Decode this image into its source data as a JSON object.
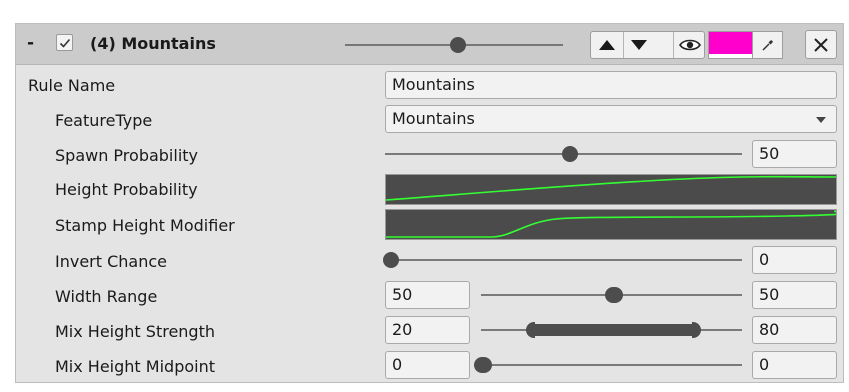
{
  "header": {
    "collapse_symbol": "-",
    "enabled": true,
    "title": "(4) Mountains",
    "preview_slider_value": 0.52,
    "color": "#ff00cc",
    "icons": {
      "move_up": "triangle-up-icon",
      "move_down": "triangle-down-icon",
      "visibility": "eye-icon",
      "picker": "eyedropper-icon",
      "remove": "close-icon"
    }
  },
  "rows": {
    "rule_name": {
      "label": "Rule Name",
      "value": "Mountains"
    },
    "feature_type": {
      "label": "FeatureType",
      "value": "Mountains"
    },
    "spawn_probability": {
      "label": "Spawn Probability",
      "value": "50",
      "slider_value": 0.5
    },
    "height_probability": {
      "label": "Height Probability",
      "curve_color": "#33ff33"
    },
    "stamp_height_modifier": {
      "label": "Stamp Height Modifier",
      "curve_color": "#33ff33"
    },
    "invert_chance": {
      "label": "Invert Chance",
      "value": "0",
      "slider_value": 0
    },
    "width_range": {
      "label": "Width Range",
      "min": "50",
      "max": "50",
      "range_min": 50,
      "range_max": 50,
      "scale_max": 100
    },
    "mix_height_strength": {
      "label": "Mix Height Strength",
      "min": "20",
      "max": "80",
      "range_min": 20,
      "range_max": 80,
      "scale_max": 100
    },
    "mix_height_midpoint": {
      "label": "Mix Height Midpoint",
      "min": "0",
      "max": "0",
      "range_min": 0,
      "range_max": 0,
      "scale_max": 100
    }
  }
}
